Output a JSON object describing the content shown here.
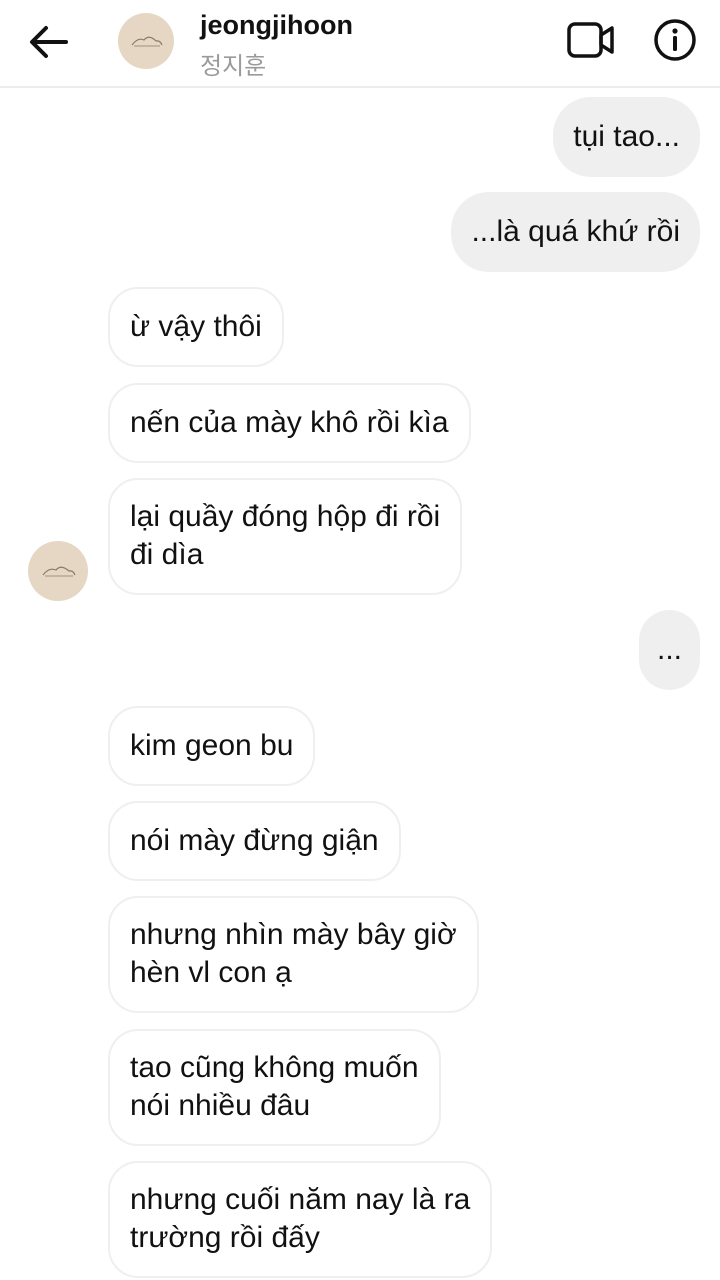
{
  "header": {
    "name": "jeongjihoon",
    "subtitle": "정지훈",
    "back_icon": "arrow-left-icon",
    "video_icon": "video-camera-icon",
    "info_icon": "info-circle-icon"
  },
  "messages": [
    {
      "from": "me",
      "text": "tụi tao..."
    },
    {
      "from": "me",
      "text": "...là quá khứ rồi"
    },
    {
      "from": "them",
      "text": "ừ vậy thôi"
    },
    {
      "from": "them",
      "text": "nến của mày khô rồi kìa"
    },
    {
      "from": "them",
      "text": "lại quầy đóng hộp đi rồi\nđi dìa"
    },
    {
      "from": "me",
      "text": "..."
    },
    {
      "from": "them",
      "text": "kim geon bu"
    },
    {
      "from": "them",
      "text": "nói mày đừng giận"
    },
    {
      "from": "them",
      "text": "nhưng nhìn mày bây giờ\nhèn vl con ạ"
    },
    {
      "from": "them",
      "text": "tao cũng không muốn\nnói nhiều đâu"
    },
    {
      "from": "them",
      "text": "nhưng cuối năm nay là ra\ntrường rồi đấy"
    }
  ],
  "colors": {
    "outgoing_bubble": "#efefef",
    "incoming_border": "#efefef",
    "avatar_bg": "#e5d7c3",
    "subtitle": "#9a9a9a"
  }
}
